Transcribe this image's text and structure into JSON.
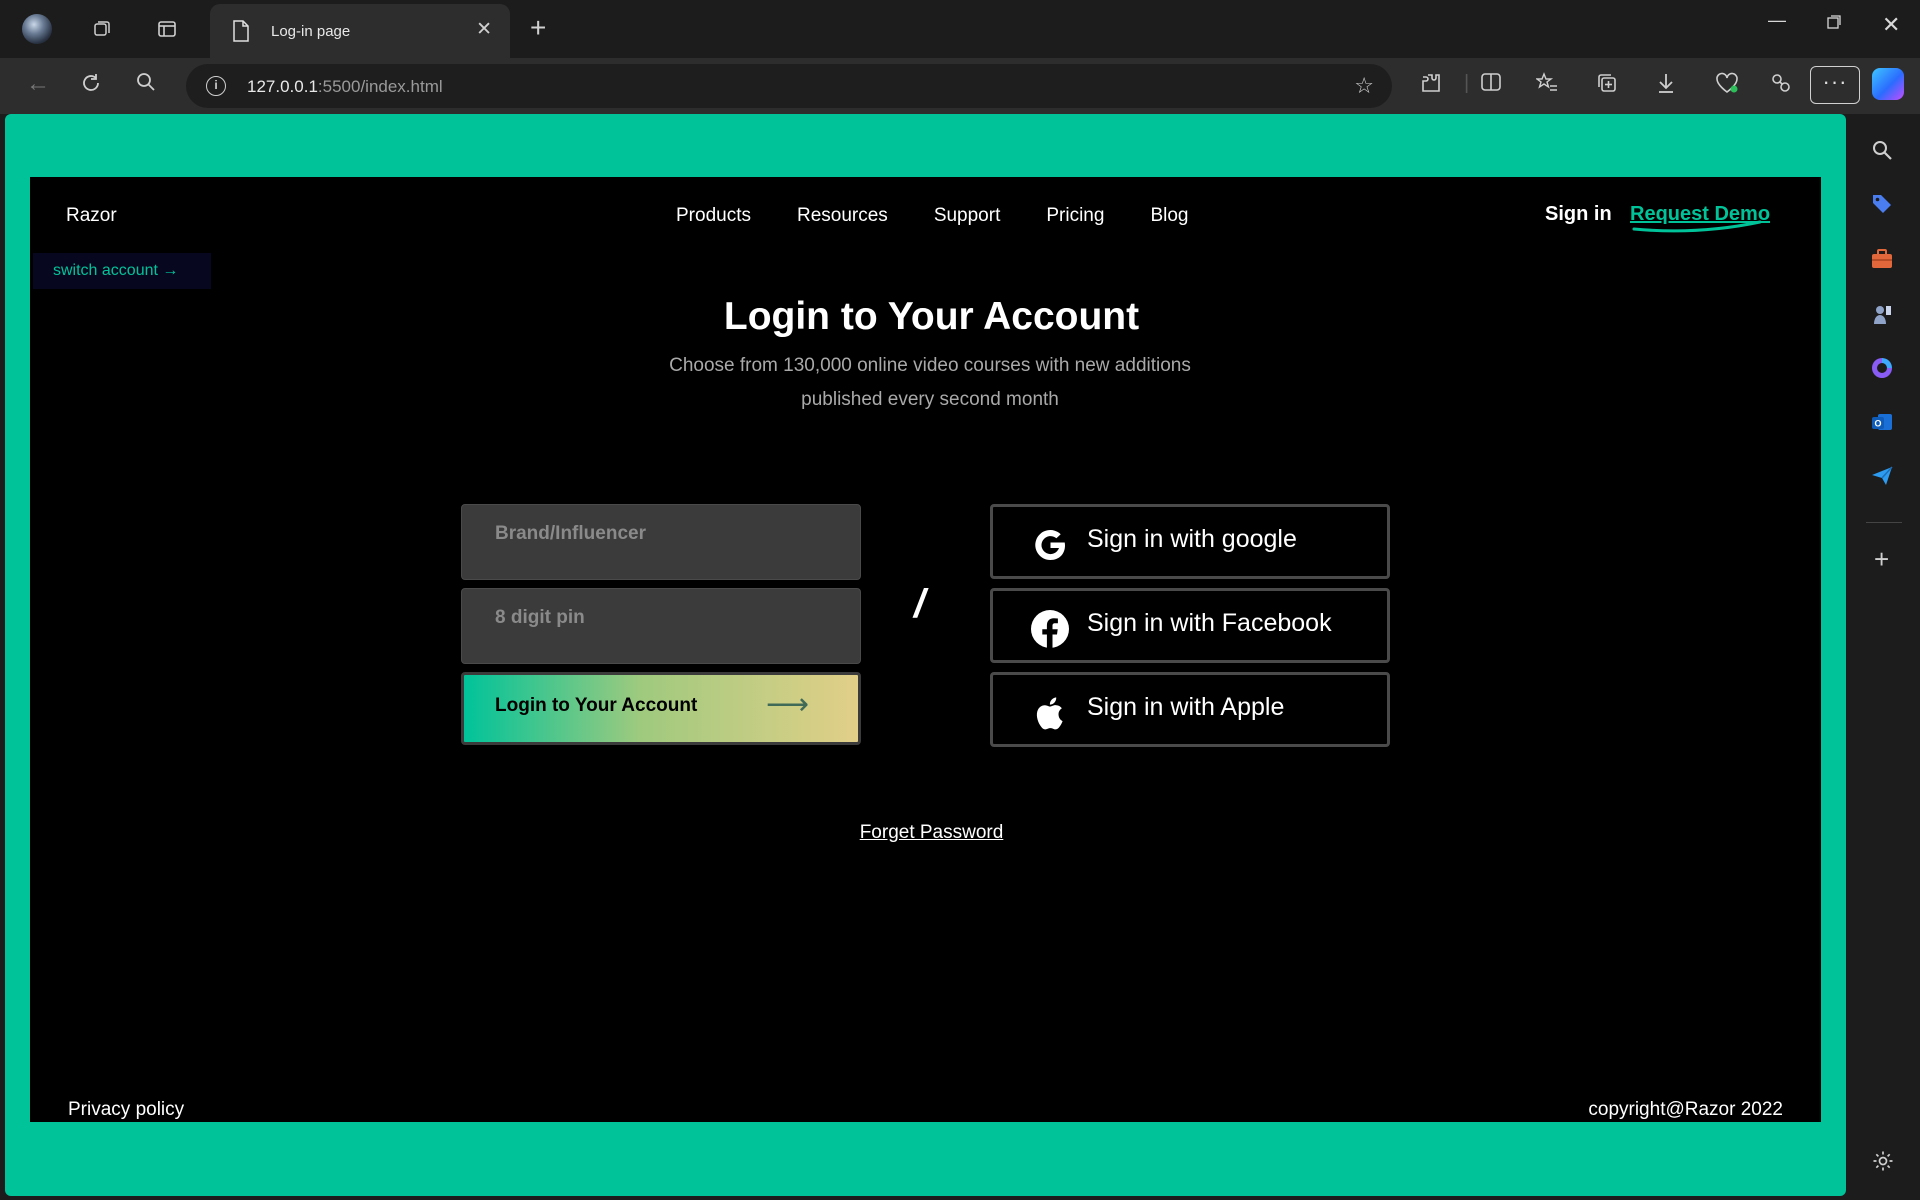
{
  "browser": {
    "tab_title": "Log-in page",
    "url_host": "127.0.0.1",
    "url_path": ":5500/index.html",
    "more_label": "···"
  },
  "header": {
    "brand": "Razor",
    "nav": [
      "Products",
      "Resources",
      "Support",
      "Pricing",
      "Blog"
    ],
    "sign_in": "Sign in",
    "request_demo": "Request Demo"
  },
  "switch_account": "switch account →",
  "hero": {
    "title": "Login to Your Account",
    "subtitle": "Choose from 130,000 online video courses with new additions published every second month"
  },
  "form": {
    "brand_placeholder": "Brand/Influencer",
    "pin_placeholder": "8 digit pin",
    "login_label": "Login to Your Account",
    "login_arrow": "⟶"
  },
  "divider": "/",
  "social": {
    "google": "Sign in with google",
    "facebook": "Sign in with Facebook",
    "apple": "Sign in with Apple"
  },
  "forgot_password": "Forget Password",
  "footer": {
    "privacy": "Privacy policy",
    "copyright": "copyright@Razor 2022"
  },
  "colors": {
    "accent": "#00c39a",
    "page_bg": "#000000",
    "field_bg": "#3b3b3b"
  },
  "icons": {
    "sidebar": [
      "search-icon",
      "tag-icon",
      "briefcase-icon",
      "chess-icon",
      "copilot-icon",
      "outlook-icon",
      "send-icon",
      "plus-icon",
      "settings-icon"
    ]
  }
}
